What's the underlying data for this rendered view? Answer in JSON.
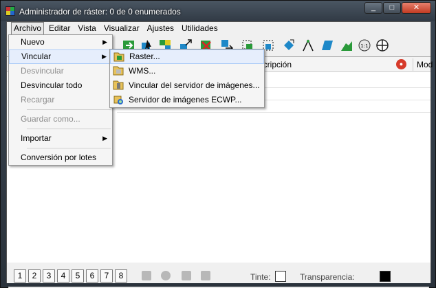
{
  "window": {
    "title": "Administrador de ráster: 0 de 0 enumerados"
  },
  "caption_buttons": [
    "_",
    "□",
    "✕"
  ],
  "menubar": [
    "Archivo",
    "Editar",
    "Vista",
    "Visualizar",
    "Ajustes",
    "Utilidades"
  ],
  "archivo_menu": [
    {
      "label": "Nuevo",
      "submenu": true,
      "disabled": false
    },
    {
      "label": "Vincular",
      "submenu": true,
      "disabled": false,
      "highlighted": true
    },
    {
      "label": "Desvincular",
      "disabled": true
    },
    {
      "label": "Desvincular todo",
      "disabled": false
    },
    {
      "label": "Recargar",
      "disabled": true
    },
    {
      "label": "Guardar como...",
      "disabled": true
    },
    {
      "label": "Importar",
      "submenu": true,
      "disabled": false
    },
    {
      "label": "Conversión por lotes",
      "disabled": false
    }
  ],
  "vincular_submenu": [
    {
      "label": "Raster...",
      "icon": "raster-file-icon",
      "highlighted": true
    },
    {
      "label": "WMS...",
      "icon": "wms-file-icon"
    },
    {
      "label": "Vincular del servidor de imágenes...",
      "icon": "image-server-file-icon"
    },
    {
      "label": "Servidor de imágenes ECWP...",
      "icon": "ecwp-server-icon"
    }
  ],
  "columns": {
    "description": "escripción",
    "mod": "Mod"
  },
  "statusbar": {
    "view_buttons": [
      "1",
      "2",
      "3",
      "4",
      "5",
      "6",
      "7",
      "8"
    ],
    "tint_label": "Tinte:",
    "transparency_label": "Transparencia:"
  },
  "colors": {
    "highlight": "#e6eefc",
    "highlight_border": "#aecdf8",
    "title_bg": "#3b4652"
  }
}
